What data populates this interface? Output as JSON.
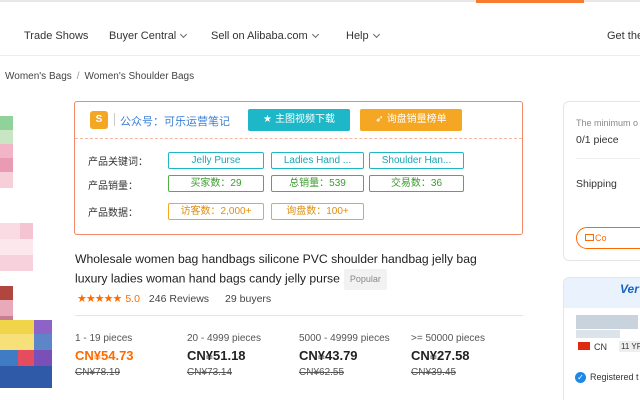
{
  "nav": {
    "items": [
      {
        "label": "Trade Shows",
        "dropdown": false
      },
      {
        "label": "Buyer Central",
        "dropdown": true
      },
      {
        "label": "Sell on Alibaba.com",
        "dropdown": true
      },
      {
        "label": "Help",
        "dropdown": true
      }
    ],
    "right_label": "Get the"
  },
  "breadcrumb": {
    "items": [
      "Women's Bags",
      "Women's Shoulder Bags"
    ],
    "separator": "/"
  },
  "plugin": {
    "logo_text": "S",
    "wechat_text": "公众号：可乐运营笔记",
    "video_button": "主图视频下载",
    "sales_button": "询盘销量榜单",
    "keywords_label": "产品关键词：",
    "keywords": [
      "Jelly Purse",
      "Ladies Hand ...",
      "Shoulder Han..."
    ],
    "sales_label": "产品销量：",
    "sales": [
      "买家数：29",
      "总销量：539",
      "交易数：36"
    ],
    "data_label": "产品数据：",
    "data": [
      "访客数：2,000+",
      "询盘数：100+"
    ]
  },
  "product": {
    "title": "Wholesale women bag handbags silicone PVC shoulder handbag jelly bag luxury ladies woman hand bags candy jelly purse",
    "badge": "Popular",
    "stars": "★★★★★",
    "rating": "5.0",
    "reviews": "246 Reviews",
    "buyers": "29 buyers"
  },
  "pricing": {
    "tiers": [
      {
        "qty": "1 - 19 pieces",
        "price": "CN¥54.73",
        "old": "CN¥78.19"
      },
      {
        "qty": "20 - 4999 pieces",
        "price": "CN¥51.18",
        "old": "CN¥73.14"
      },
      {
        "qty": "5000 - 49999 pieces",
        "price": "CN¥43.79",
        "old": "CN¥62.55"
      },
      {
        "qty": ">= 50000 pieces",
        "price": "CN¥27.58",
        "old": "CN¥39.45"
      }
    ]
  },
  "side": {
    "min_text": "The minimum o",
    "pieces": "0/1 piece",
    "shipping": "Shipping",
    "contact": "Co",
    "verified": "Ver",
    "country": "CN",
    "years": "11 YR",
    "registered": "Registered t"
  },
  "colors": {
    "accent": "#ff6a00",
    "cyan": "#1db7c7",
    "green": "#52b043",
    "amber": "#f5a623"
  }
}
